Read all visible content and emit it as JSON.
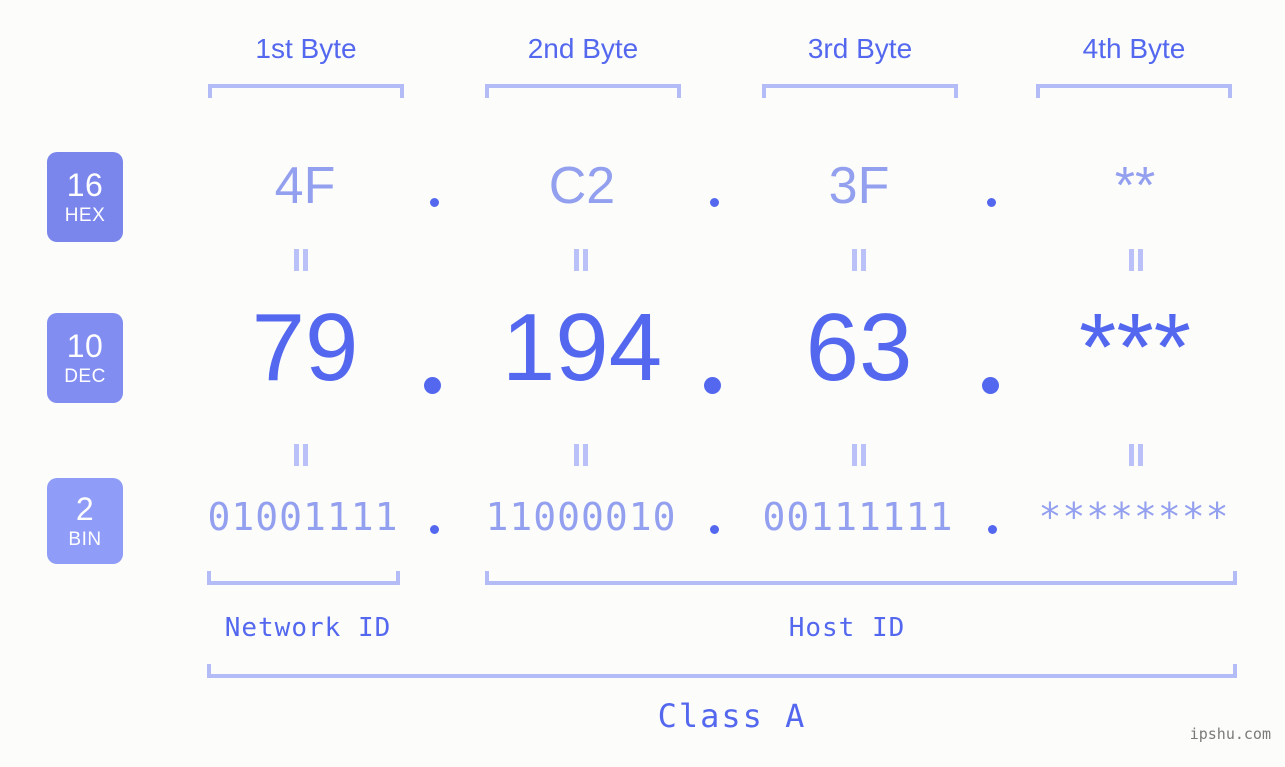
{
  "meta": {
    "background_color": "#fcfdfa",
    "accent_strong": "#5468ef",
    "accent_light": "#939fef",
    "accent_pale": "#b3bcf7",
    "badge_fill_hex": "#7b86ec",
    "badge_fill_dec": "#818df0",
    "badge_fill_bin": "#8f9cf8"
  },
  "headers": [
    {
      "label": "1st Byte"
    },
    {
      "label": "2nd Byte"
    },
    {
      "label": "3rd Byte"
    },
    {
      "label": "4th Byte"
    }
  ],
  "bases": [
    {
      "number": "16",
      "name": "HEX"
    },
    {
      "number": "10",
      "name": "DEC"
    },
    {
      "number": "2",
      "name": "BIN"
    }
  ],
  "rows": {
    "hex": {
      "bytes": [
        "4F",
        "C2",
        "3F",
        "**"
      ],
      "separator": "."
    },
    "dec": {
      "bytes": [
        "79",
        "194",
        "63",
        "***"
      ],
      "separator": "."
    },
    "bin": {
      "bytes": [
        "01001111",
        "11000010",
        "00111111",
        "********"
      ],
      "separator": "."
    }
  },
  "equality_symbol": "=",
  "segments": {
    "network_id": "Network ID",
    "host_id": "Host ID",
    "class": "Class A"
  },
  "watermark": "ipshu.com"
}
